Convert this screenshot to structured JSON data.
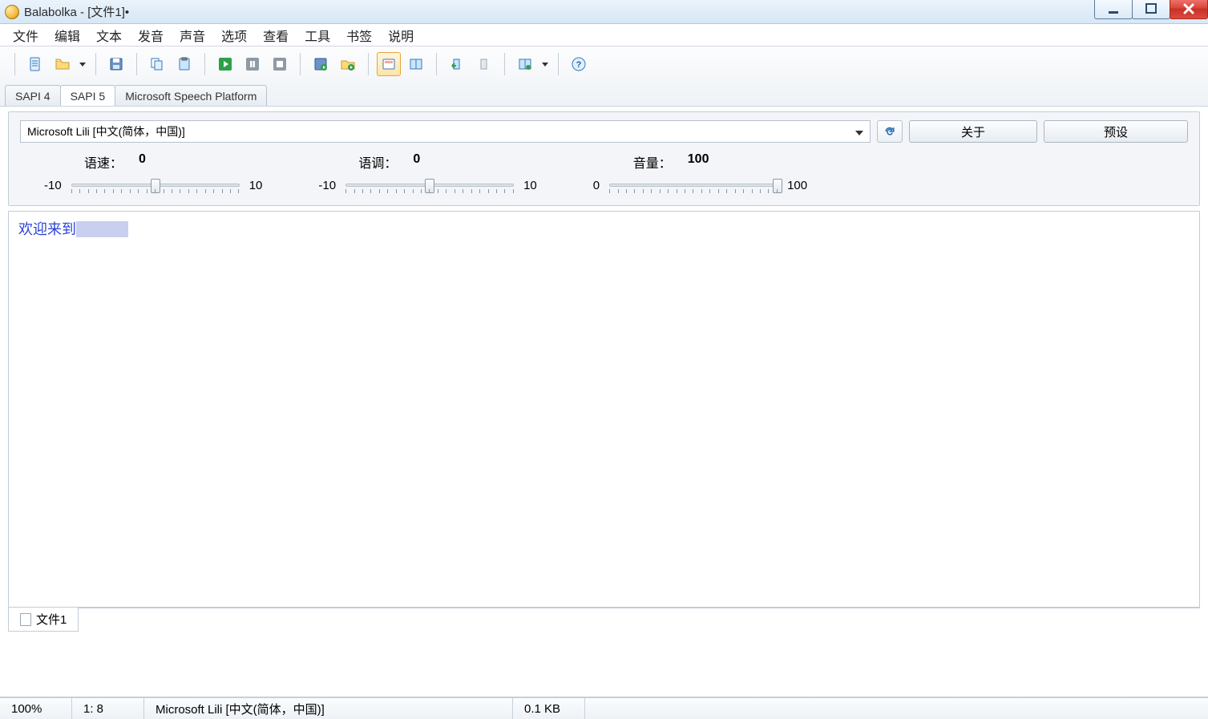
{
  "title": "Balabolka - [文件1]•",
  "menu": [
    "文件",
    "编辑",
    "文本",
    "发音",
    "声音",
    "选项",
    "查看",
    "工具",
    "书签",
    "说明"
  ],
  "engine_tabs": [
    "SAPI 4",
    "SAPI 5",
    "Microsoft Speech Platform"
  ],
  "engine_tabs_selected_index": 1,
  "voice": {
    "selected": "Microsoft Lili [中文(简体，中国)]",
    "about_btn": "关于",
    "preset_btn": "预设"
  },
  "sliders": {
    "rate": {
      "label": "语速：",
      "value": "0",
      "min": "-10",
      "max": "10",
      "pos": 0.5
    },
    "pitch": {
      "label": "语调：",
      "value": "0",
      "min": "-10",
      "max": "10",
      "pos": 0.5
    },
    "vol": {
      "label": "音量：",
      "value": "100",
      "min": "0",
      "max": "100",
      "pos": 1.0
    }
  },
  "editor_text": "欢迎来到",
  "doc_tab": "文件1",
  "status": {
    "zoom": "100%",
    "cursor": "1:  8",
    "voice": "Microsoft Lili [中文(简体，中国)]",
    "size": "0.1 KB"
  }
}
